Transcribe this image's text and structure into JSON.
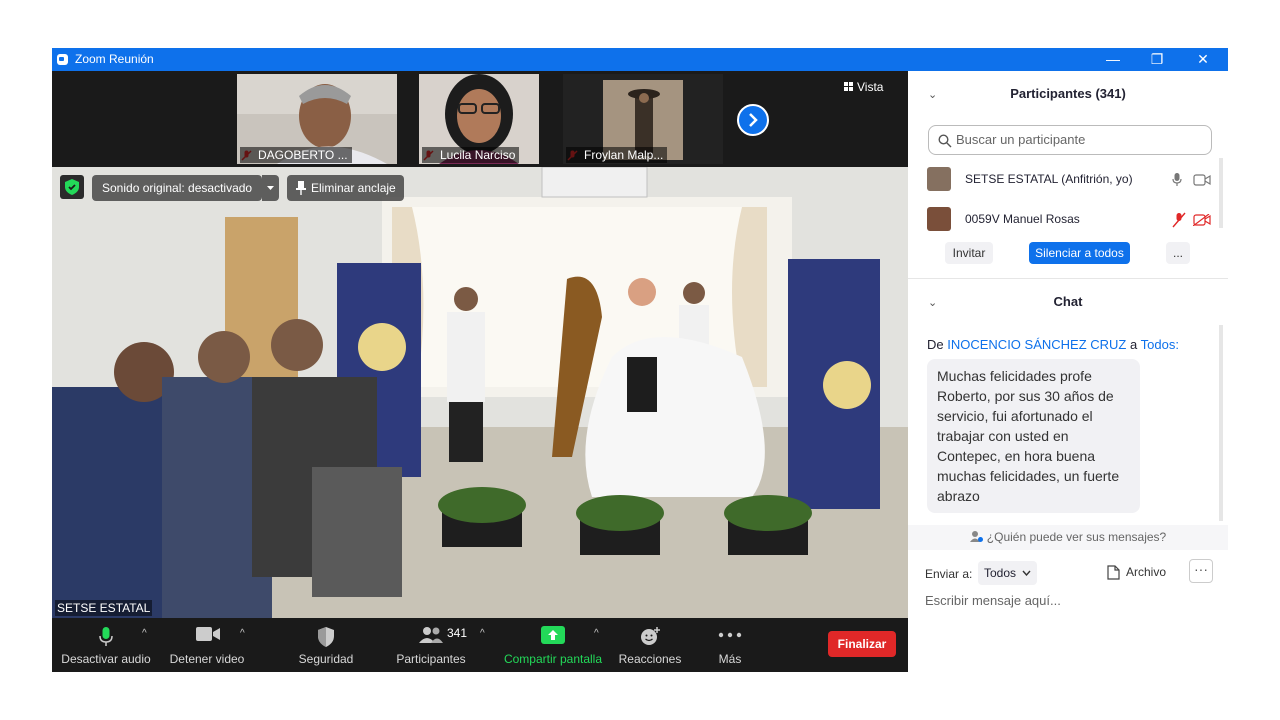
{
  "window": {
    "title": "Zoom Reunión",
    "minimize_icon": "—",
    "restore_icon": "❐",
    "close_icon": "✕"
  },
  "strip": {
    "thumbnails": [
      {
        "name": "DAGOBERTO ..."
      },
      {
        "name": "Lucila Narciso"
      },
      {
        "name": "Froylan Malp..."
      }
    ],
    "view_label": "Vista"
  },
  "main_video": {
    "sound_label": "Sonido original: desactivado",
    "unpin_label": "Eliminar anclaje",
    "self_name": "SETSE ESTATAL"
  },
  "toolbar": {
    "mute_label": "Desactivar audio",
    "video_label": "Detener video",
    "security_label": "Seguridad",
    "participants_label": "Participantes",
    "participants_count": "341",
    "share_label": "Compartir pantalla",
    "reactions_label": "Reacciones",
    "more_label": "Más",
    "end_label": "Finalizar"
  },
  "participants_panel": {
    "title": "Participantes (341)",
    "search_placeholder": "Buscar un participante",
    "rows": [
      {
        "name": "SETSE ESTATAL (Anfitrión, yo)"
      },
      {
        "name": "0059V Manuel Rosas"
      }
    ],
    "invite_label": "Invitar",
    "mute_all_label": "Silenciar a todos",
    "more_label": "..."
  },
  "chat_panel": {
    "title": "Chat",
    "from_prefix": "De",
    "sender": "INOCENCIO SÁNCHEZ CRUZ",
    "to_word": "a",
    "recipient_inline": "Todos:",
    "message": "Muchas felicidades profe Roberto, por sus 30 años de servicio, fui afortunado el trabajar con usted en Contepec, en hora buena muchas felicidades, un fuerte abrazo",
    "who_can_see": "¿Quién puede ver sus mensajes?",
    "send_to_label": "Enviar a:",
    "recipient": "Todos",
    "file_label": "Archivo",
    "more_label": "···",
    "input_placeholder": "Escribir mensaje aquí..."
  },
  "colors": {
    "accent": "#0e71eb",
    "end": "#e02828",
    "share": "#23d959",
    "muted": "#e02828"
  }
}
